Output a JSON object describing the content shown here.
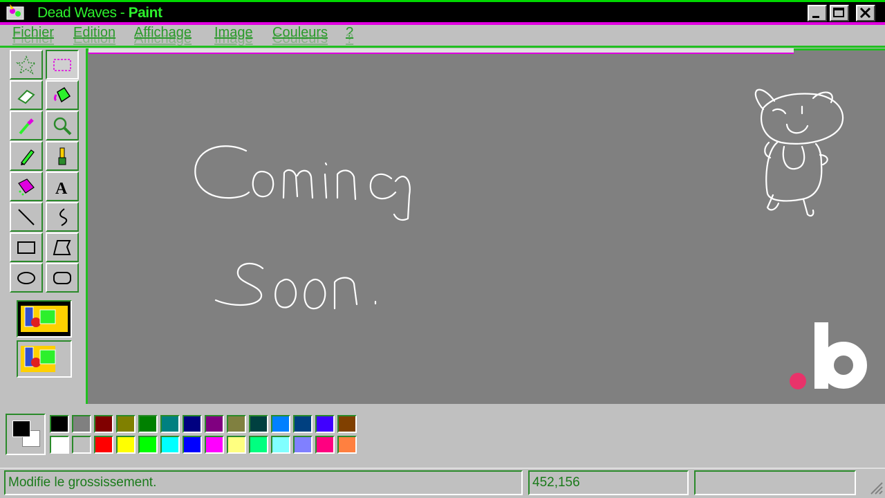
{
  "window": {
    "title_prefix": "Dead Waves - ",
    "title_app": "Paint"
  },
  "menu": [
    "Fichier",
    "Edition",
    "Affichage",
    "Image",
    "Couleurs",
    "?"
  ],
  "canvas": {
    "line1": "Coming",
    "line2": "Soon."
  },
  "palette": {
    "top": [
      "#000000",
      "#808080",
      "#800000",
      "#808000",
      "#008000",
      "#008080",
      "#000080",
      "#800080",
      "#808040",
      "#004040",
      "#0080ff",
      "#004080",
      "#4000ff",
      "#804000"
    ],
    "bottom": [
      "#ffffff",
      "#c0c0c0",
      "#ff0000",
      "#ffff00",
      "#00ff00",
      "#00ffff",
      "#0000ff",
      "#ff00ff",
      "#ffff80",
      "#00ff80",
      "#80ffff",
      "#8080ff",
      "#ff0080",
      "#ff8040"
    ]
  },
  "status": {
    "message": "Modifie le grossissement.",
    "coords": "452,156",
    "extra": ""
  },
  "colors": {
    "accent_green": "#2cf02c",
    "accent_magenta": "#e000e0",
    "brand_dot": "#e8336a"
  },
  "icons": [
    "app-paint-icon",
    "minimize-icon",
    "maximize-icon",
    "close-icon",
    "free-select-icon",
    "rect-select-icon",
    "eraser-icon",
    "fill-icon",
    "color-picker-icon",
    "magnifier-icon",
    "pencil-icon",
    "brush-icon",
    "airbrush-icon",
    "text-icon",
    "line-icon",
    "curve-icon",
    "rectangle-icon",
    "polygon-icon",
    "ellipse-icon",
    "rounded-rect-icon",
    "resize-grip-icon",
    "brand-logo"
  ]
}
